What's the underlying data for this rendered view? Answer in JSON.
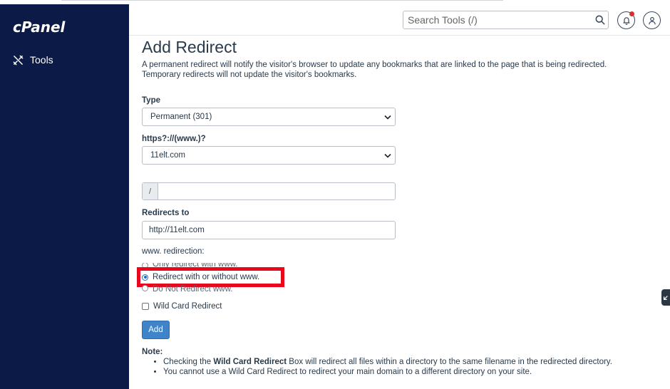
{
  "app": {
    "logo_text": "cPanel"
  },
  "sidebar": {
    "items": [
      {
        "label": "Tools",
        "icon": "tools-icon"
      }
    ]
  },
  "header": {
    "search_placeholder": "Search Tools (/)",
    "icons": [
      "search-icon",
      "bell-icon",
      "user-icon"
    ],
    "notification_dot_color": "#d9302c"
  },
  "page": {
    "title": "Add Redirect",
    "description": "A permanent redirect will notify the visitor's browser to update any bookmarks that are linked to the page that is being redirected. Temporary redirects will not update the visitor's bookmarks."
  },
  "form": {
    "type_label": "Type",
    "type_value": "Permanent (301)",
    "domain_label": "https?://(www.)?",
    "domain_value": "11elt.com",
    "path_prefix": "/",
    "path_value": "",
    "redirects_to_label": "Redirects to",
    "redirects_to_value": "http://11elt.com",
    "www_label": "www. redirection:",
    "www_options": [
      {
        "label": "Only redirect with www.",
        "selected": false
      },
      {
        "label": "Redirect with or without www.",
        "selected": true
      },
      {
        "label": "Do Not Redirect www.",
        "selected": false
      }
    ],
    "wildcard_label": "Wild Card Redirect",
    "wildcard_checked": false,
    "add_button": "Add"
  },
  "note": {
    "title": "Note:",
    "item1_before": "Checking the ",
    "item1_bold": "Wild Card Redirect",
    "item1_after": " Box will redirect all files within a directory to the same filename in the redirected directory.",
    "item2": "You cannot use a Wild Card Redirect to redirect your main domain to a different directory on your site."
  },
  "colors": {
    "sidebar_bg": "#0b1a46",
    "primary_button": "#3f84c8",
    "highlight_border": "#e8071b"
  }
}
